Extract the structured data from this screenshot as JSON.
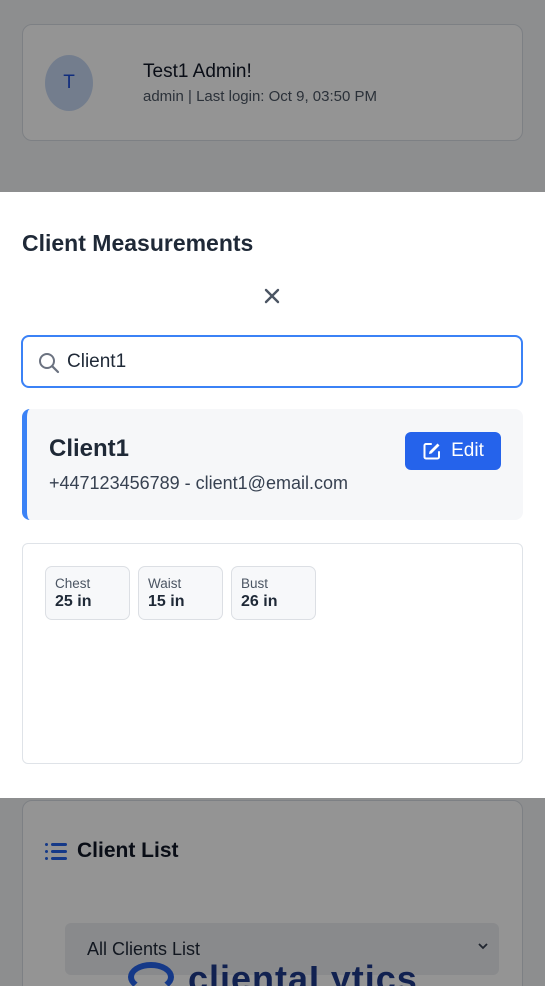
{
  "background": {
    "profile": {
      "avatar_initial": "T",
      "name": "Test1 Admin!",
      "meta": "admin | Last login: Oct 9, 03:50 PM"
    },
    "client_list": {
      "title": "Client List",
      "select_value": "All Clients List"
    },
    "brand_text": "clientaLytics"
  },
  "modal": {
    "title": "Client Measurements",
    "search": {
      "value": "Client1",
      "placeholder": ""
    },
    "client": {
      "name": "Client1",
      "contact": "+447123456789 - client1@email.com",
      "edit_label": "Edit"
    },
    "measurements": [
      {
        "label": "Chest",
        "value": "25 in"
      },
      {
        "label": "Waist",
        "value": "15 in"
      },
      {
        "label": "Bust",
        "value": "26 in"
      }
    ]
  },
  "colors": {
    "accent": "#2563eb",
    "focus_border": "#3b82f6",
    "overlay": "rgba(0,0,0,0.42)"
  }
}
